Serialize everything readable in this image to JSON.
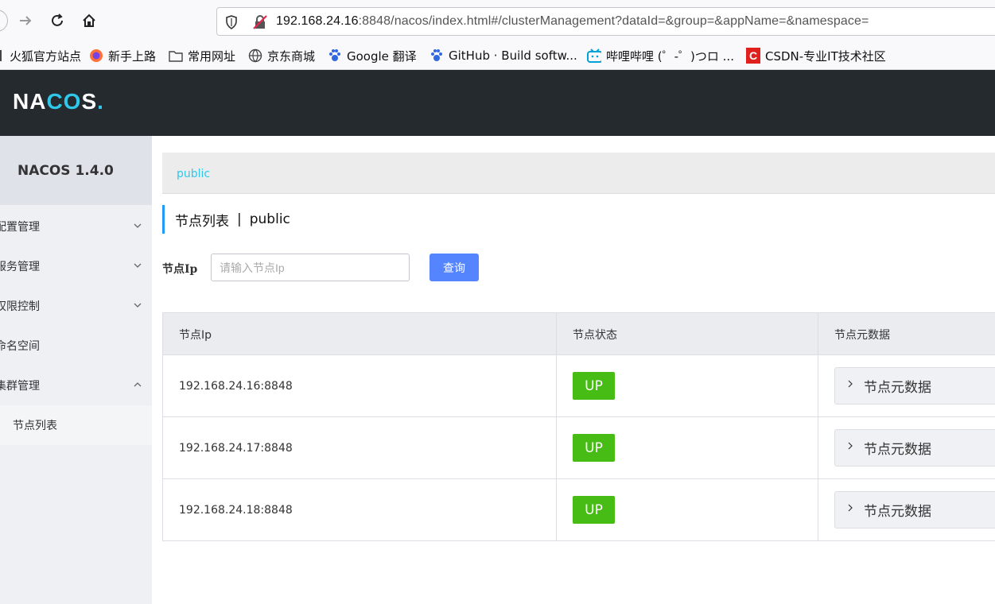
{
  "browser": {
    "url_host": "192.168.24.16",
    "url_rest": ":8848/nacos/index.html#/clusterManagement?dataId=&group=&appName=&namespace=",
    "bookmarks": [
      {
        "label": "火狐官方站点",
        "icon": "firefox-icon"
      },
      {
        "label": "新手上路",
        "icon": "firefox-icon"
      },
      {
        "label": "常用网址",
        "icon": "folder-icon"
      },
      {
        "label": "京东商城",
        "icon": "globe-icon"
      },
      {
        "label": "Google 翻译",
        "icon": "baidu-paw-icon"
      },
      {
        "label": "GitHub · Build softw...",
        "icon": "baidu-paw-icon"
      },
      {
        "label": "哔哩哔哩 (゜-゜)つロ ...",
        "icon": "bilibili-icon"
      },
      {
        "label": "CSDN-专业IT技术社区",
        "icon": "csdn-icon"
      }
    ]
  },
  "header": {
    "logo": "NACOS."
  },
  "sidebar": {
    "title": "NACOS 1.4.0",
    "items": [
      {
        "label": "配置管理",
        "expanded": false
      },
      {
        "label": "服务管理",
        "expanded": false
      },
      {
        "label": "权限控制",
        "expanded": false
      },
      {
        "label": "命名空间"
      },
      {
        "label": "集群管理",
        "expanded": true
      }
    ],
    "subitems": [
      {
        "label": "节点列表"
      }
    ]
  },
  "main": {
    "breadcrumb": "public",
    "title": "节点列表",
    "title_sep": "|",
    "namespace": "public",
    "filter": {
      "label": "节点Ip",
      "placeholder": "请输入节点Ip",
      "button": "查询"
    },
    "table": {
      "headers": [
        "节点Ip",
        "节点状态",
        "节点元数据"
      ],
      "rows": [
        {
          "ip": "192.168.24.16:8848",
          "status": "UP",
          "meta": "节点元数据"
        },
        {
          "ip": "192.168.24.17:8848",
          "status": "UP",
          "meta": "节点元数据"
        },
        {
          "ip": "192.168.24.18:8848",
          "status": "UP",
          "meta": "节点元数据"
        }
      ]
    }
  },
  "colors": {
    "header_bg": "#252a2f",
    "accent": "#2fc8ea",
    "primary_button": "#5584ff",
    "status_up": "#46bc15"
  }
}
